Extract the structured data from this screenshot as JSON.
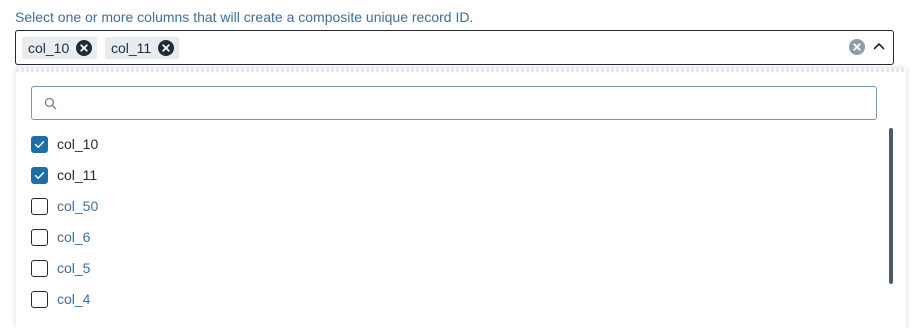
{
  "prompt": "Select one or more columns that will create a composite unique record ID.",
  "selected_chips": [
    {
      "label": "col_10"
    },
    {
      "label": "col_11"
    }
  ],
  "search": {
    "placeholder": "",
    "value": ""
  },
  "options": [
    {
      "label": "col_10",
      "checked": true
    },
    {
      "label": "col_11",
      "checked": true
    },
    {
      "label": "col_50",
      "checked": false
    },
    {
      "label": "col_6",
      "checked": false
    },
    {
      "label": "col_5",
      "checked": false
    },
    {
      "label": "col_4",
      "checked": false
    }
  ],
  "colors": {
    "accent": "#1e6fa8",
    "text_dark": "#1f2b36",
    "text_muted": "#3f6e98"
  },
  "icons": {
    "chip_remove": "close-circle-icon",
    "clear_all": "close-circle-icon",
    "toggle": "chevron-up-icon",
    "search": "search-icon",
    "check": "checkmark-icon"
  }
}
